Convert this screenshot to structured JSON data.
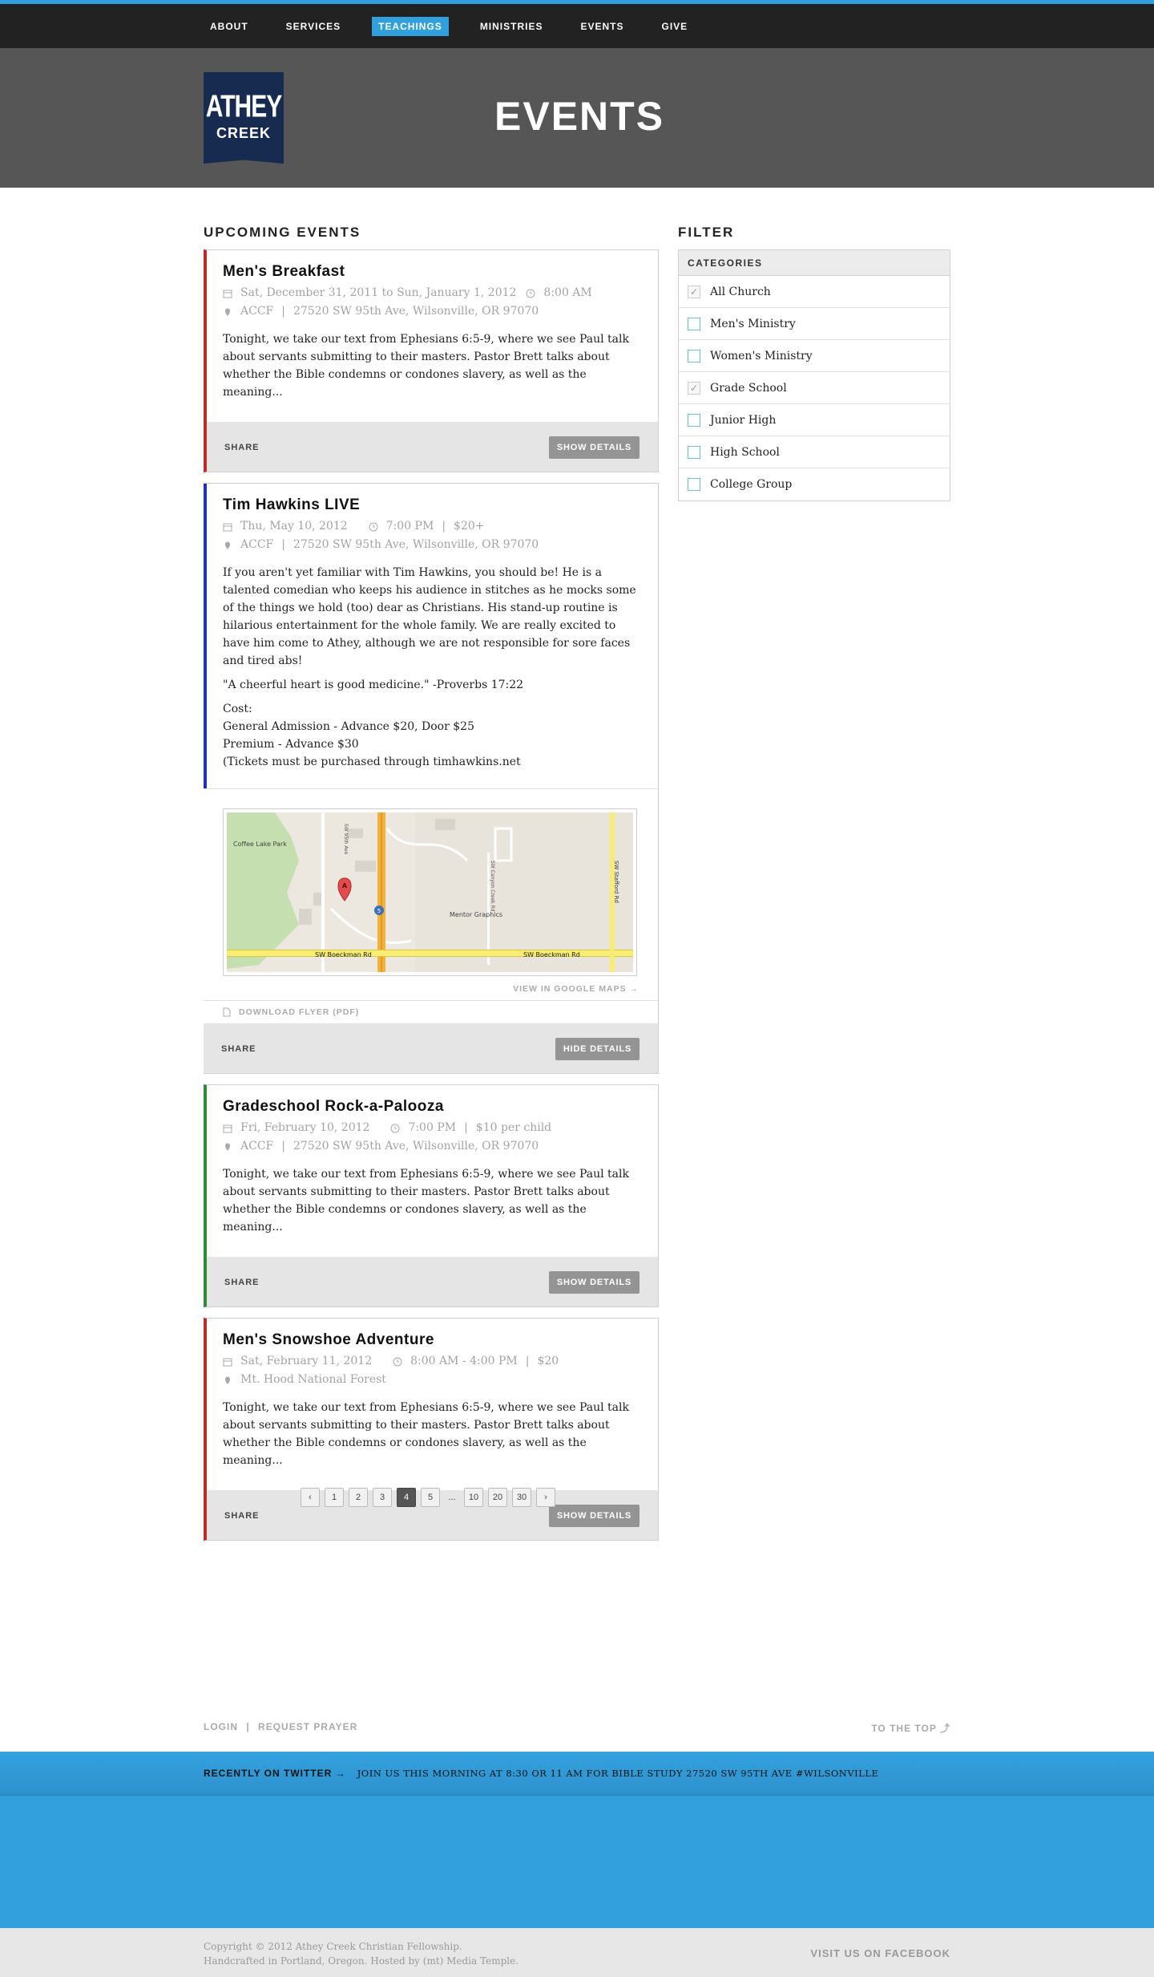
{
  "nav": {
    "items": [
      "About",
      "Services",
      "Teachings",
      "Ministries",
      "Events",
      "Give"
    ],
    "active_index": 2
  },
  "brand": {
    "logo_line1": "ATHEY",
    "logo_line2": "CREEK",
    "logo_color": "#172b50"
  },
  "page": {
    "title": "EVENTS"
  },
  "events_section": {
    "title": "UPCOMING EVENTS"
  },
  "filter": {
    "title": "FILTER",
    "header": "CATEGORIES",
    "categories": [
      {
        "label": "All Church",
        "checked": true
      },
      {
        "label": "Men's Ministry",
        "checked": false
      },
      {
        "label": "Women's Ministry",
        "checked": false
      },
      {
        "label": "Grade School",
        "checked": true
      },
      {
        "label": "Junior High",
        "checked": false
      },
      {
        "label": "High School",
        "checked": false
      },
      {
        "label": "College Group",
        "checked": false
      }
    ]
  },
  "events": [
    {
      "title": "Men's Breakfast",
      "date": "Sat, December 31, 2011 to Sun, January 1, 2012",
      "time": "8:00 AM",
      "location": "ACCF",
      "address": "27520 SW 95th Ave, Wilsonville, OR 97070",
      "description": "Tonight, we take our text from Ephesians 6:5-9, where we see Paul talk about servants submitting to their masters. Pastor Brett talks about whether the Bible condemns or condones slavery, as well as the meaning...",
      "share": "SHARE",
      "button": "SHOW DETAILS",
      "accent": "#c32a26"
    },
    {
      "title": "Tim Hawkins LIVE",
      "date": "Thu, May 10, 2012",
      "time": "7:00 PM",
      "price": "$20+",
      "location": "ACCF",
      "address": "27520 SW 95th Ave, Wilsonville, OR 97070",
      "description": "If you aren't yet familiar with Tim Hawkins, you should be! He is a talented comedian who keeps his audience in stitches as he mocks some of the things we hold (too) dear as Christians. His stand-up routine is hilarious entertainment for the whole family. We are really excited to have him come to Athey, although we are not responsible for sore faces and tired abs!",
      "quote": "\"A cheerful heart is good medicine.\" -Proverbs 17:22",
      "cost_lines": [
        "Cost:",
        "General Admission - Advance $20, Door $25",
        "Premium - Advance $30",
        "(Tickets must be purchased through timhawkins.net"
      ],
      "map_link": "VIEW IN GOOGLE MAPS →",
      "flyer": "DOWNLOAD FLYER (PDF)",
      "map_labels": {
        "park": "Coffee Lake Park",
        "road1": "SW Boeckman Rd",
        "road2": "SW Boeckman Rd",
        "road3": "SW 95th Ave",
        "road4": "SW Canyon Creek Rd",
        "road5": "SW Stafford Rd",
        "poi": "Mentor Graphics",
        "marker": "A",
        "shield": "5"
      },
      "share": "SHARE",
      "button": "HIDE DETAILS",
      "accent": "#1f2fbf"
    },
    {
      "title": "Gradeschool Rock-a-Palooza",
      "date": "Fri, February 10, 2012",
      "time": "7:00 PM",
      "price": "$10 per child",
      "location": "ACCF",
      "address": "27520 SW 95th Ave, Wilsonville, OR 97070",
      "description": "Tonight, we take our text from Ephesians 6:5-9, where we see Paul talk about servants submitting to their masters. Pastor Brett talks about whether the Bible condemns or condones slavery, as well as the meaning...",
      "share": "SHARE",
      "button": "SHOW DETAILS",
      "accent": "#2e8a36"
    },
    {
      "title": "Men's Snowshoe Adventure",
      "date": "Sat, February 11, 2012",
      "time": "8:00 AM - 4:00 PM",
      "price": "$20",
      "location": "Mt. Hood National Forest",
      "description": "Tonight, we take our text from Ephesians 6:5-9, where we see Paul talk about servants submitting to their masters. Pastor Brett talks about whether the Bible condemns or condones slavery, as well as the meaning...",
      "share": "SHARE",
      "button": "SHOW DETAILS",
      "accent": "#c32a26"
    }
  ],
  "pagination": {
    "prev": "‹",
    "pages": [
      "1",
      "2",
      "3",
      "4",
      "5",
      "...",
      "10",
      "20",
      "30"
    ],
    "active": "4",
    "next": "›"
  },
  "footer_links": {
    "login": "LOGIN",
    "divider": "|",
    "prayer": "REQUEST PRAYER",
    "top": "TO THE TOP ⤴"
  },
  "twitter": {
    "label": "RECENTLY ON TWITTER →",
    "text": "JOIN US THIS MORNING AT 8:30 OR 11 AM FOR BIBLE STUDY 27520 SW 95TH AVE #WILSONVILLE"
  },
  "footer": {
    "copyright": "Copyright © 2012 Athey Creek Christian Fellowship.",
    "credits": "Handcrafted in Portland, Oregon. Hosted by (mt) Media Temple.",
    "facebook": "VISIT US ON FACEBOOK"
  },
  "colors": {
    "brand_blue": "#33a0de",
    "nav_bg": "#222222",
    "hero_bg": "#565656"
  }
}
